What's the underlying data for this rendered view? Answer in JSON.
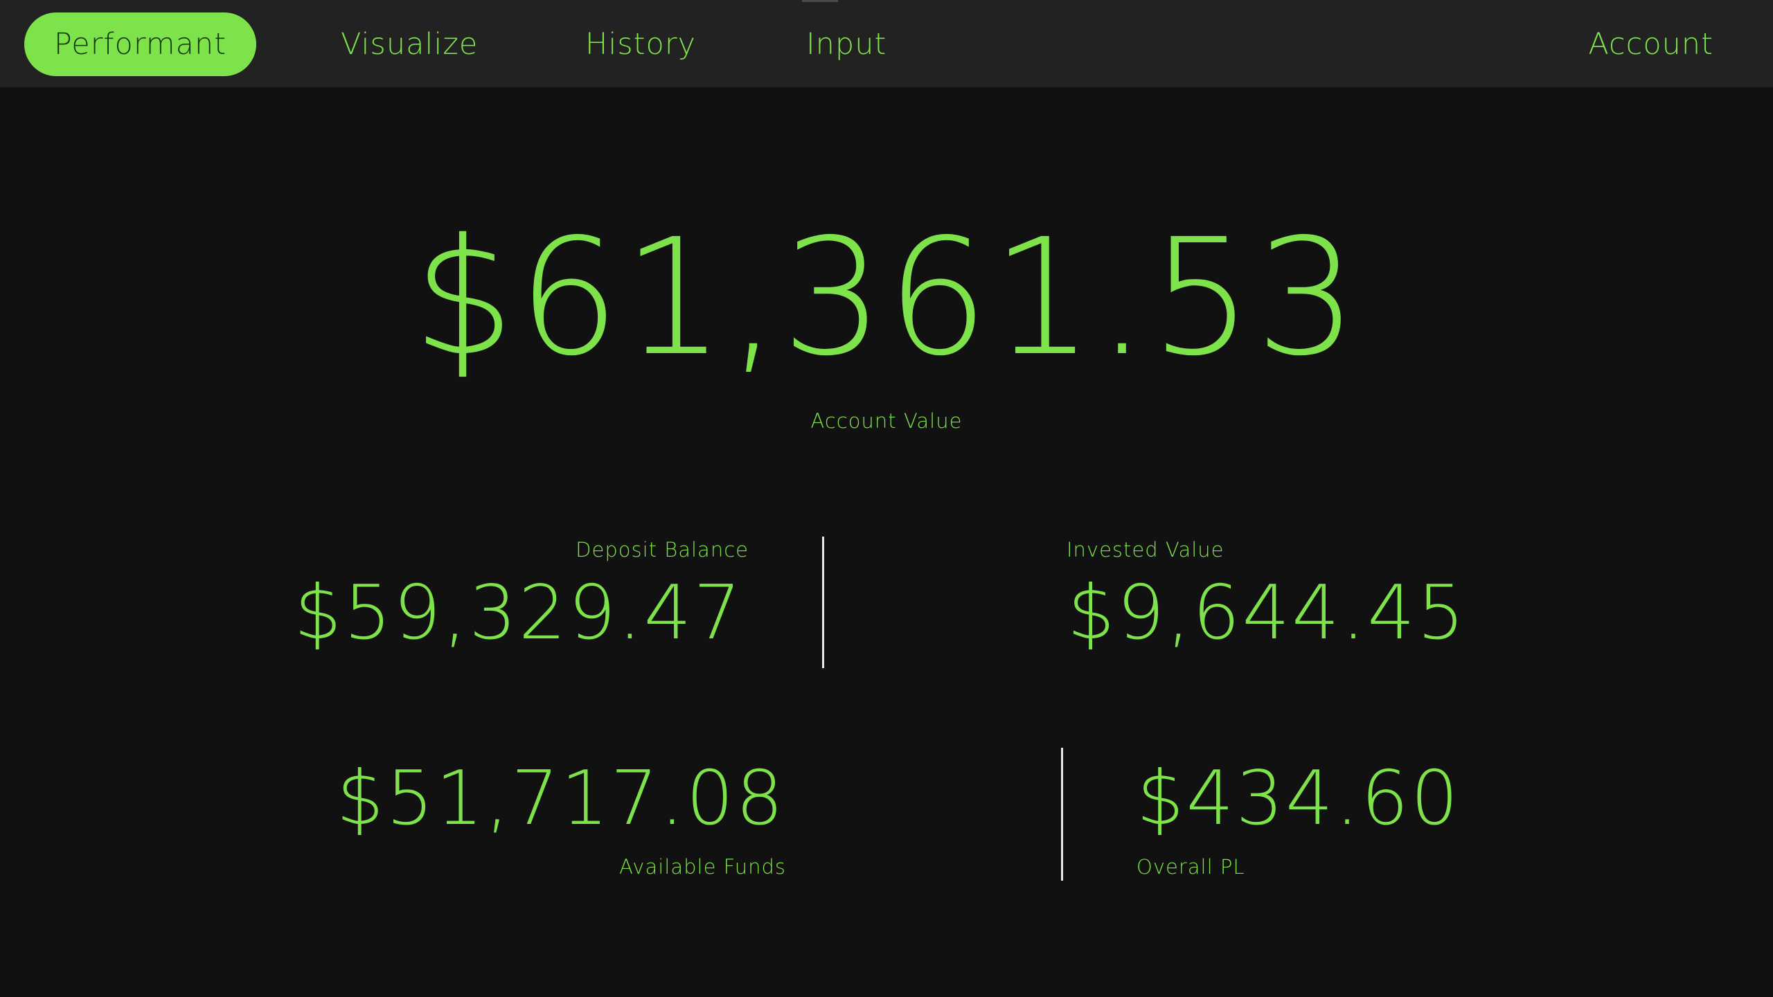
{
  "nav": {
    "brand": "Performant",
    "items": [
      {
        "label": "Visualize"
      },
      {
        "label": "History"
      },
      {
        "label": "Input"
      }
    ],
    "account": "Account"
  },
  "account_value": {
    "value": "$61,361.53",
    "label": "Account Value"
  },
  "stats": {
    "deposit_balance": {
      "label": "Deposit Balance",
      "value": "$59,329.47"
    },
    "invested_value": {
      "label": "Invested Value",
      "value": "$9,644.45"
    },
    "available_funds": {
      "label": "Available Funds",
      "value": "$51,717.08"
    },
    "overall_pl": {
      "label": "Overall PL",
      "value": "$434.60"
    }
  },
  "colors": {
    "accent": "#7ee34a",
    "background": "#111111",
    "topbar": "#222222",
    "divider": "#e8e8e8"
  }
}
